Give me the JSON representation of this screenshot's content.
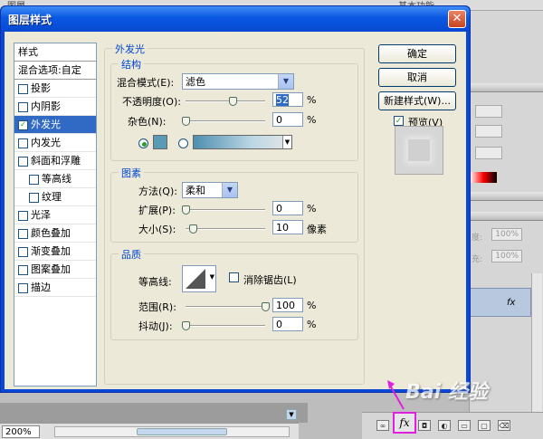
{
  "background": {
    "top_left_text": "图層",
    "top_right_text": "基本功能",
    "panel_values": [
      "100%",
      "100%"
    ],
    "panel_labels": [
      "度:",
      "充:"
    ],
    "zoom": "200%",
    "fx_label": "fx"
  },
  "dialog": {
    "title": "图层样式",
    "close": "✕",
    "style_list": {
      "header": "样式",
      "blend_options": "混合选项:自定",
      "items": [
        {
          "label": "投影",
          "checked": false
        },
        {
          "label": "内阴影",
          "checked": false
        },
        {
          "label": "外发光",
          "checked": true,
          "selected": true
        },
        {
          "label": "内发光",
          "checked": false
        },
        {
          "label": "斜面和浮雕",
          "checked": false
        },
        {
          "label": "等高线",
          "checked": false,
          "indent": true
        },
        {
          "label": "纹理",
          "checked": false,
          "indent": true
        },
        {
          "label": "光泽",
          "checked": false
        },
        {
          "label": "颜色叠加",
          "checked": false
        },
        {
          "label": "渐变叠加",
          "checked": false
        },
        {
          "label": "图案叠加",
          "checked": false
        },
        {
          "label": "描边",
          "checked": false
        }
      ]
    },
    "outer_glow": {
      "title": "外发光",
      "structure": {
        "title": "结构",
        "blend_mode_label": "混合模式(E):",
        "blend_mode_value": "滤色",
        "opacity_label": "不透明度(O):",
        "opacity_value": "52",
        "noise_label": "杂色(N):",
        "noise_value": "0",
        "unit": "%"
      },
      "elements": {
        "title": "图素",
        "method_label": "方法(Q):",
        "method_value": "柔和",
        "spread_label": "扩展(P):",
        "spread_value": "0",
        "size_label": "大小(S):",
        "size_value": "10",
        "unit_pct": "%",
        "unit_px": "像素"
      },
      "quality": {
        "title": "品质",
        "contour_label": "等高线:",
        "antialias_label": "消除锯齿(L)",
        "range_label": "范围(R):",
        "range_value": "100",
        "jitter_label": "抖动(J):",
        "jitter_value": "0",
        "unit": "%"
      }
    },
    "buttons": {
      "ok": "确定",
      "cancel": "取消",
      "new_style": "新建样式(W)...",
      "preview_label": "预览(V)"
    },
    "glow_color": "#5b9ab5"
  },
  "watermark": "Bai 经验"
}
